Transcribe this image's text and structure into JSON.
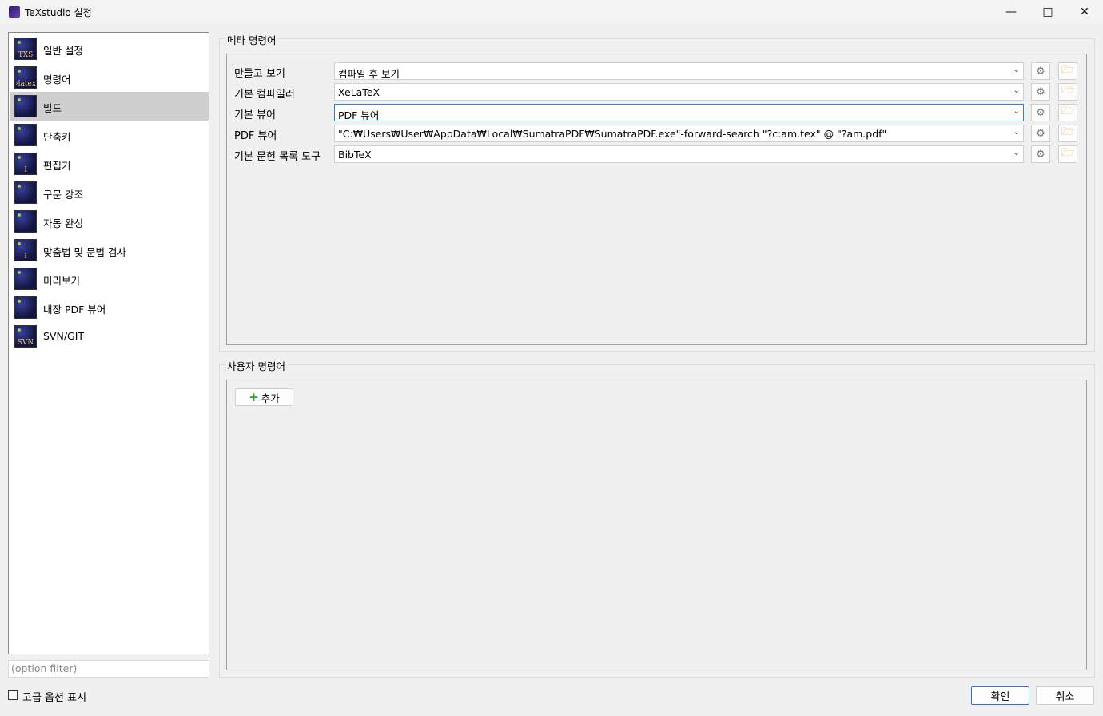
{
  "window": {
    "title": "TeXstudio 설정"
  },
  "sidebar": {
    "items": [
      {
        "label": "일반 설정",
        "icon_text": "TXS"
      },
      {
        "label": "명령어",
        "icon_text": "›latex"
      },
      {
        "label": "빌드",
        "icon_text": ""
      },
      {
        "label": "단축키",
        "icon_text": ""
      },
      {
        "label": "편집기",
        "icon_text": "I"
      },
      {
        "label": "구문 강조",
        "icon_text": ""
      },
      {
        "label": "자동 완성",
        "icon_text": ""
      },
      {
        "label": "맞춤법 및 문법 검사",
        "icon_text": "I"
      },
      {
        "label": "미리보기",
        "icon_text": ""
      },
      {
        "label": "내장 PDF 뷰어",
        "icon_text": ""
      },
      {
        "label": "SVN/GIT",
        "icon_text": "SVN"
      }
    ],
    "selected_index": 2
  },
  "filter": {
    "placeholder": "(option filter)"
  },
  "advanced": {
    "label": "고급 옵션 표시",
    "checked": false
  },
  "meta": {
    "title": "메타 명령어",
    "rows": [
      {
        "label": "만들고 보기",
        "value": "컴파일 후 보기"
      },
      {
        "label": "기본 컴파일러",
        "value": "XeLaTeX"
      },
      {
        "label": "기본 뷰어",
        "value": "PDF 뷰어"
      },
      {
        "label": "PDF 뷰어",
        "value": "\"C:₩Users₩User₩AppData₩Local₩SumatraPDF₩SumatraPDF.exe\"-forward-search \"?c:am.tex\" @ \"?am.pdf\""
      },
      {
        "label": "기본 문헌 목록 도구",
        "value": "BibTeX"
      }
    ]
  },
  "user": {
    "title": "사용자 명령어",
    "add_label": "추가"
  },
  "buttons": {
    "ok": "확인",
    "cancel": "취소"
  }
}
